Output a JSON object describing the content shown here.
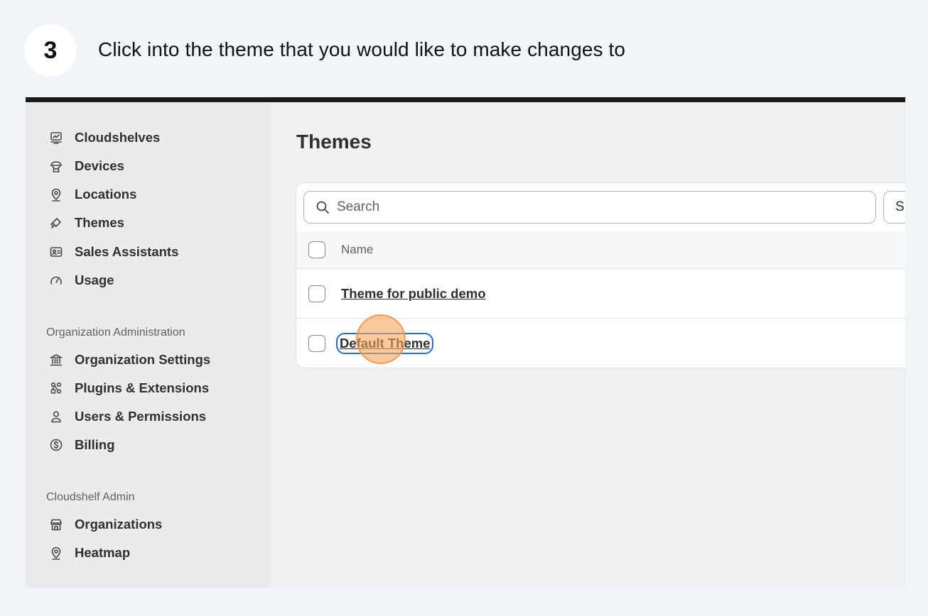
{
  "step": {
    "number": "3",
    "instruction": "Click into the theme that you would like to make changes to"
  },
  "sidebar": {
    "items": [
      {
        "label": "Cloudshelves",
        "icon": "cloudshelves-icon"
      },
      {
        "label": "Devices",
        "icon": "devices-icon"
      },
      {
        "label": "Locations",
        "icon": "location-pin-icon"
      },
      {
        "label": "Themes",
        "icon": "paint-brush-icon"
      },
      {
        "label": "Sales Assistants",
        "icon": "id-card-icon"
      },
      {
        "label": "Usage",
        "icon": "gauge-icon"
      }
    ],
    "org_section_label": "Organization Administration",
    "org_items": [
      {
        "label": "Organization Settings",
        "icon": "bank-icon"
      },
      {
        "label": "Plugins & Extensions",
        "icon": "plugins-icon"
      },
      {
        "label": "Users & Permissions",
        "icon": "user-icon"
      },
      {
        "label": "Billing",
        "icon": "dollar-circle-icon"
      }
    ],
    "admin_section_label": "Cloudshelf Admin",
    "admin_items": [
      {
        "label": "Organizations",
        "icon": "store-icon"
      },
      {
        "label": "Heatmap",
        "icon": "location-pin-icon"
      }
    ]
  },
  "main": {
    "title": "Themes",
    "search": {
      "placeholder": "Search",
      "value": ""
    },
    "sort_label": "S",
    "table": {
      "column_name": "Name",
      "rows": [
        {
          "name": "Theme for public demo"
        },
        {
          "name": "Default Theme"
        }
      ]
    }
  },
  "colors": {
    "focus_ring": "#2c6ecb",
    "click_indicator": "#f7a55a",
    "frame_top_bar": "#1a1a1a"
  }
}
